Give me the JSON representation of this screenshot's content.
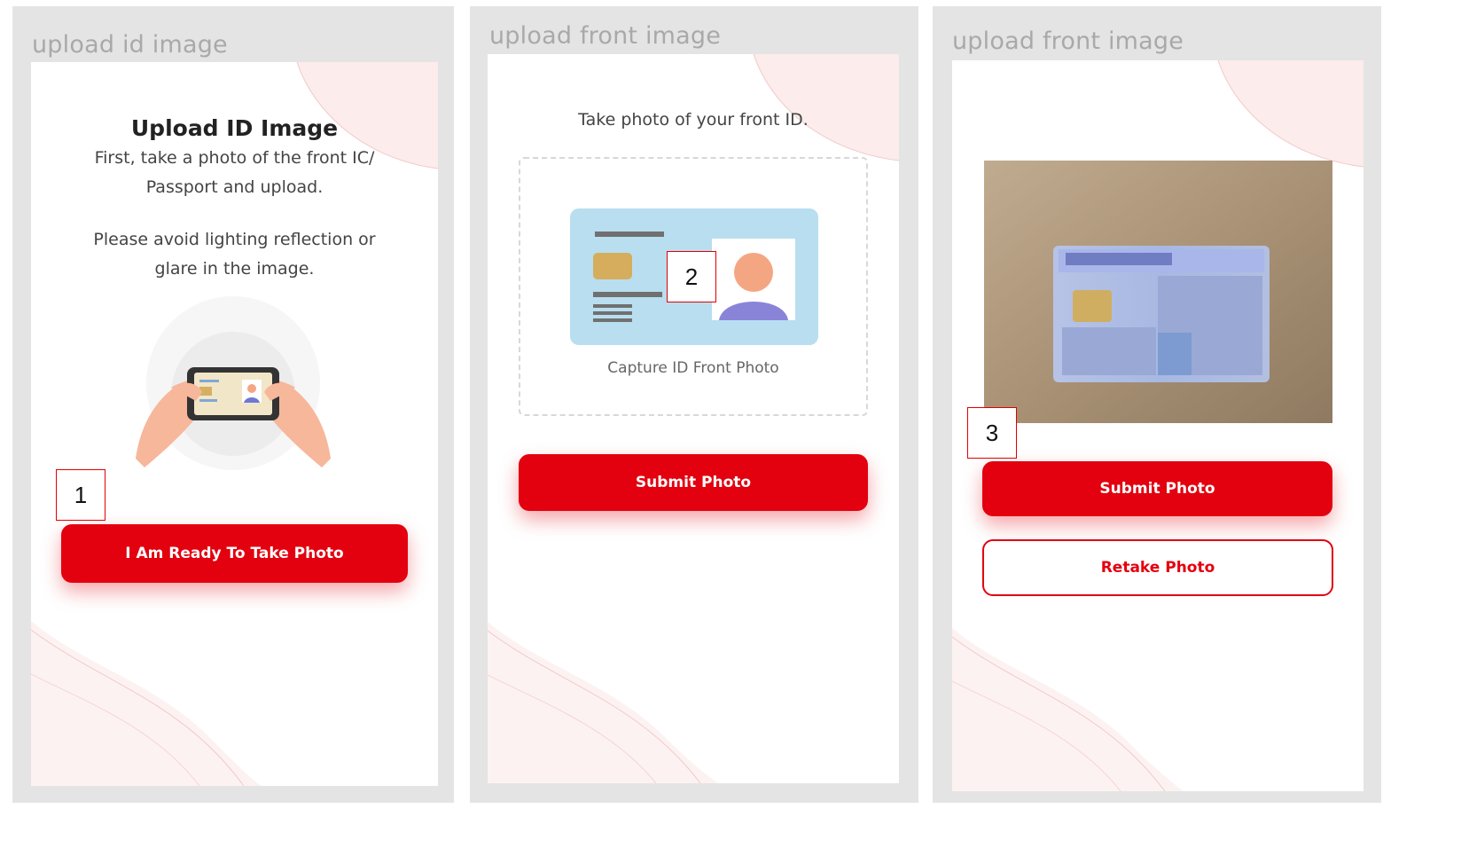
{
  "panels": [
    {
      "title": "upload id image",
      "heading": "Upload ID Image",
      "intro": "First, take a photo of the front IC/\nPassport and upload.",
      "note": "Please avoid lighting reflection or\nglare in the image.",
      "illustration_icon": "hands-holding-phone-icon",
      "button_label": "I Am Ready To Take Photo",
      "marker": "1"
    },
    {
      "title": "upload front image",
      "instruction": "Take photo of your front ID.",
      "capture_label": "Capture ID Front Photo",
      "capture_icon": "id-card-illustration-icon",
      "button_label": "Submit Photo",
      "marker": "2"
    },
    {
      "title": "upload front image",
      "photo_icon": "captured-id-photo",
      "submit_label": "Submit Photo",
      "retake_label": "Retake Photo",
      "marker": "3"
    }
  ],
  "colors": {
    "accent": "#e3000f",
    "panel_background": "#e4e4e4",
    "screen_background": "#ffffff",
    "marker_border": "#e00000"
  }
}
